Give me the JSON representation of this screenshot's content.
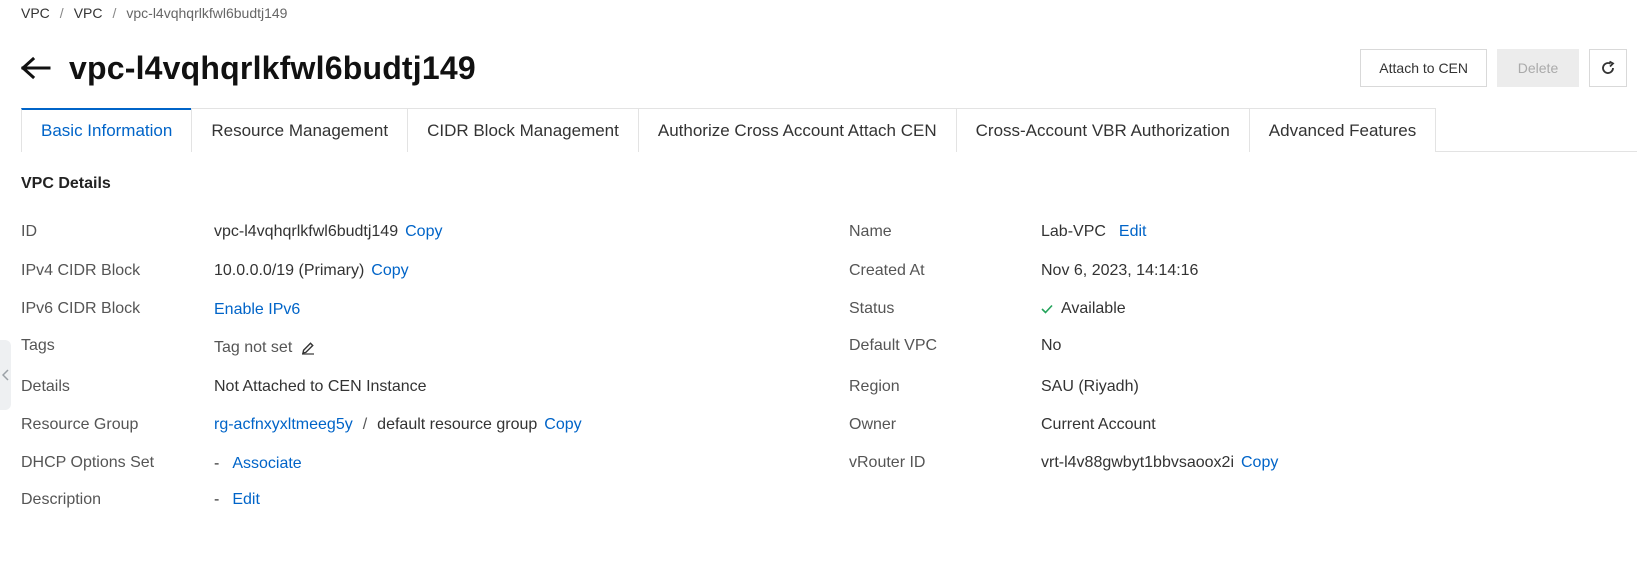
{
  "breadcrumb": {
    "items": [
      "VPC",
      "VPC",
      "vpc-l4vqhqrlkfwl6budtj149"
    ],
    "separator": "/"
  },
  "header": {
    "title": "vpc-l4vqhqrlkfwl6budtj149"
  },
  "actions": {
    "attach_label": "Attach to CEN",
    "delete_label": "Delete",
    "refresh_icon": "refresh-icon"
  },
  "tabs": [
    {
      "label": "Basic Information",
      "active": true
    },
    {
      "label": "Resource Management",
      "active": false
    },
    {
      "label": "CIDR Block Management",
      "active": false
    },
    {
      "label": "Authorize Cross Account Attach CEN",
      "active": false
    },
    {
      "label": "Cross-Account VBR Authorization",
      "active": false
    },
    {
      "label": "Advanced Features",
      "active": false
    }
  ],
  "section": {
    "title": "VPC Details"
  },
  "left": {
    "id": {
      "label": "ID",
      "value": "vpc-l4vqhqrlkfwl6budtj149",
      "action": "Copy"
    },
    "ipv4": {
      "label": "IPv4 CIDR Block",
      "value": "10.0.0.0/19 (Primary)",
      "action": "Copy"
    },
    "ipv6": {
      "label": "IPv6 CIDR Block",
      "action": "Enable IPv6"
    },
    "tags": {
      "label": "Tags",
      "value": "Tag not set"
    },
    "details": {
      "label": "Details",
      "value": "Not Attached to CEN Instance"
    },
    "resource_group": {
      "label": "Resource Group",
      "id": "rg-acfnxyxltmeeg5y",
      "separator": "/",
      "name": "default resource group",
      "action": "Copy"
    },
    "dhcp": {
      "label": "DHCP Options Set",
      "value": "-",
      "action": "Associate"
    },
    "description": {
      "label": "Description",
      "value": "-",
      "action": "Edit"
    }
  },
  "right": {
    "name": {
      "label": "Name",
      "value": "Lab-VPC",
      "action": "Edit"
    },
    "created": {
      "label": "Created At",
      "value": "Nov 6, 2023, 14:14:16"
    },
    "status": {
      "label": "Status",
      "value": "Available",
      "color": "#23a35a"
    },
    "default_vpc": {
      "label": "Default VPC",
      "value": "No"
    },
    "region": {
      "label": "Region",
      "value": "SAU (Riyadh)"
    },
    "owner": {
      "label": "Owner",
      "value": "Current Account"
    },
    "vrouter": {
      "label": "vRouter ID",
      "value": "vrt-l4v88gwbyt1bbvsaoox2i",
      "action": "Copy"
    }
  },
  "colors": {
    "accent": "#0064c8",
    "success": "#23a35a"
  }
}
